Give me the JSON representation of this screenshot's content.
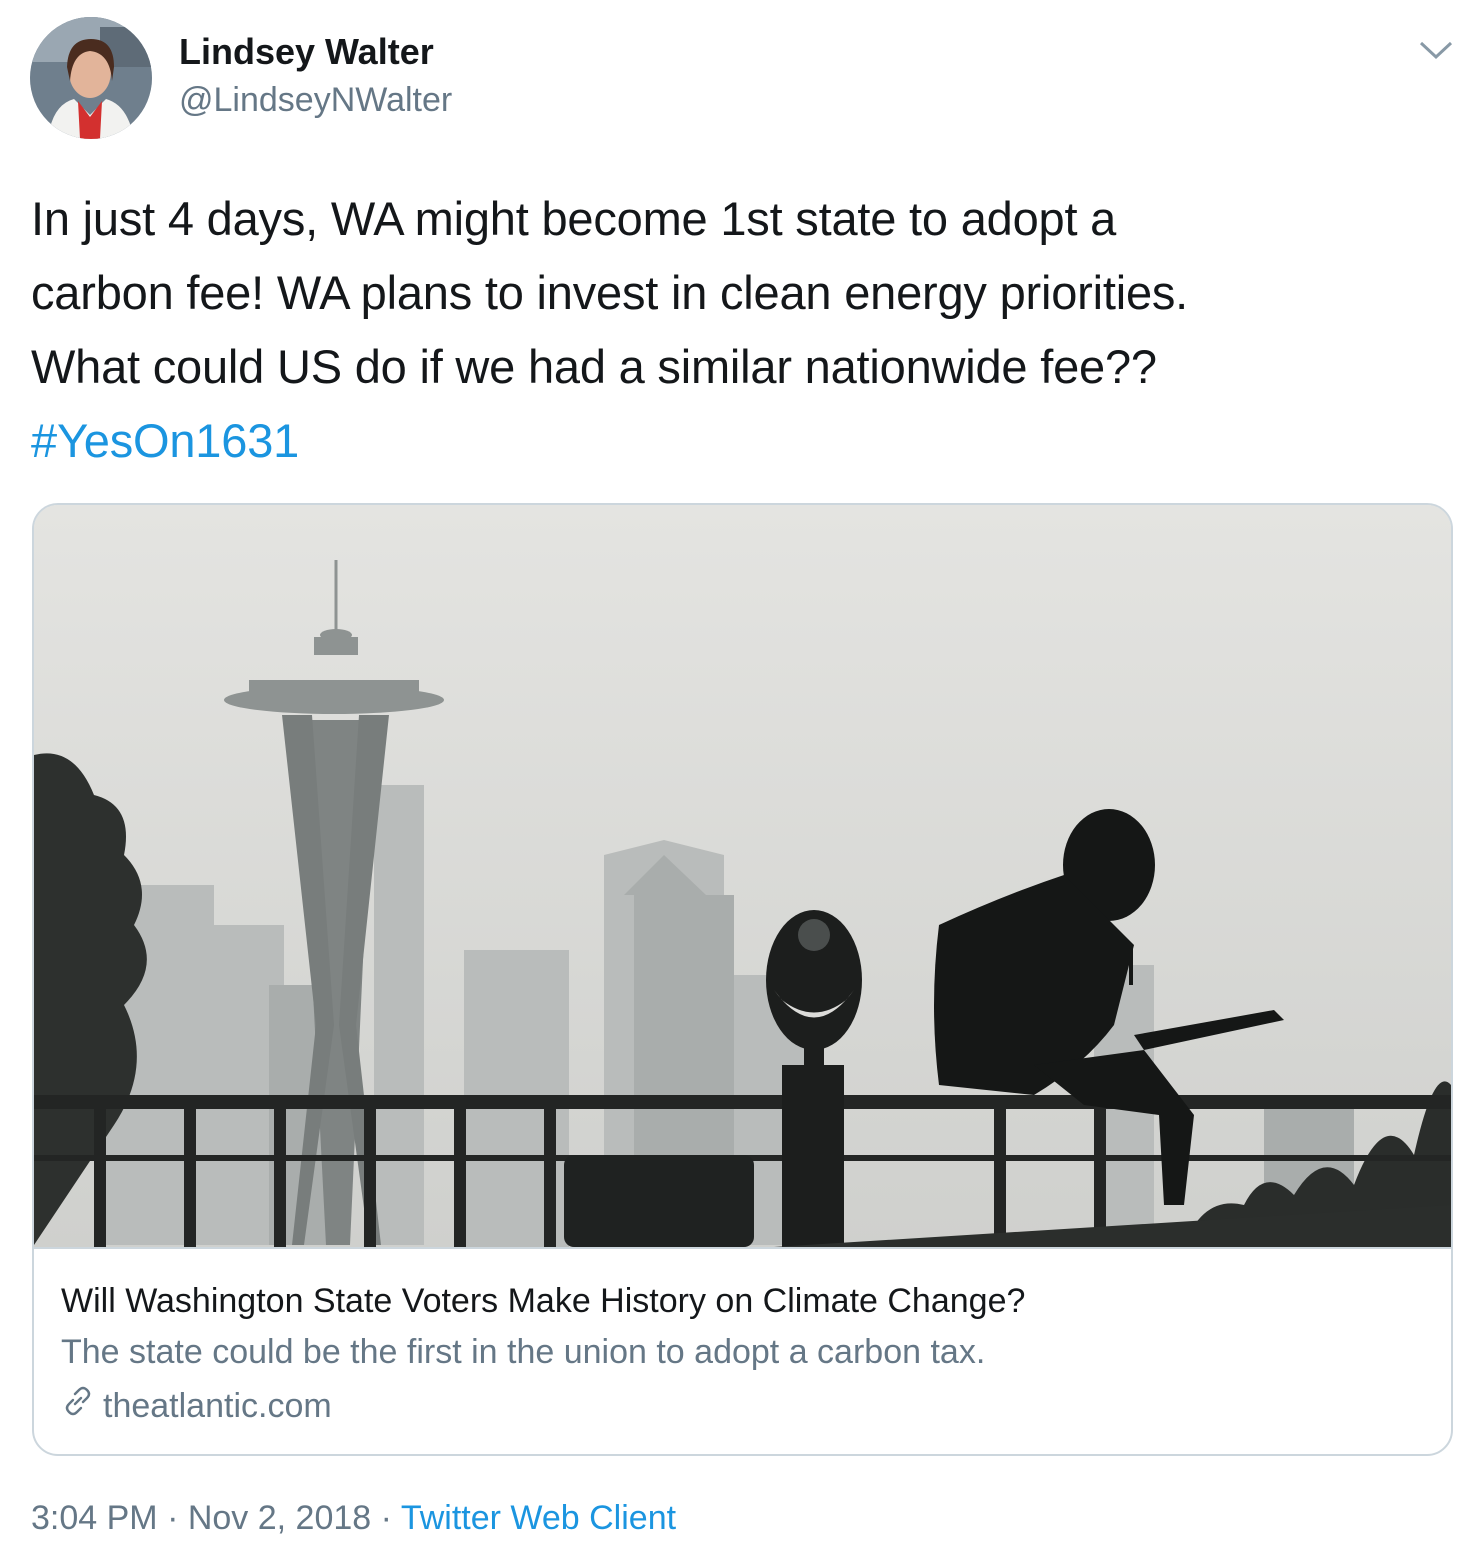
{
  "user": {
    "display_name": "Lindsey Walter",
    "handle": "@LindseyNWalter"
  },
  "tweet": {
    "lines": [
      "In just 4 days, WA might become 1st state to adopt a",
      "carbon fee! WA plans to invest in clean energy priorities.",
      "What could US do if we had a similar nationwide fee??"
    ],
    "hashtag": "#YesOn1631"
  },
  "card": {
    "title": "Will Washington State Voters Make History on Climate Change?",
    "description": "The state could be the first in the union to adopt a carbon tax.",
    "domain": "theatlantic.com"
  },
  "footer": {
    "time": "3:04 PM",
    "separator": " · ",
    "date": "Nov 2, 2018",
    "client": "Twitter Web Client"
  },
  "colors": {
    "link": "#1b95e0",
    "secondary_text": "#657786",
    "border": "#ccd6dd"
  },
  "icons": [
    "chevron-down-icon",
    "link-icon"
  ]
}
